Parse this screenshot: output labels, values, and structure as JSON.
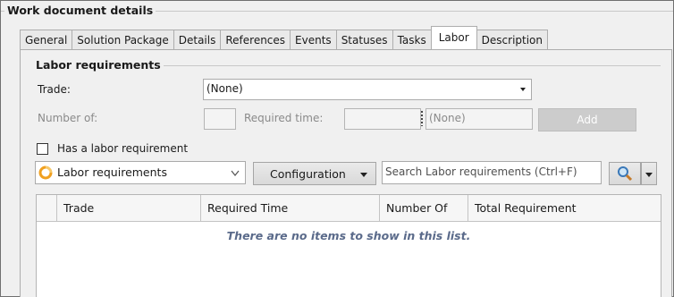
{
  "window": {
    "title": "Work document details"
  },
  "tabs": [
    {
      "label": "General"
    },
    {
      "label": "Solution Package"
    },
    {
      "label": "Details"
    },
    {
      "label": "References"
    },
    {
      "label": "Events"
    },
    {
      "label": "Statuses"
    },
    {
      "label": "Tasks"
    },
    {
      "label": "Labor",
      "active": true
    },
    {
      "label": "Description"
    }
  ],
  "labor_requirements": {
    "group_title": "Labor requirements",
    "trade_label": "Trade:",
    "trade_value": "(None)",
    "number_of_label": "Number of:",
    "number_of_value": "",
    "required_time_label": "Required time:",
    "required_time_value": "",
    "required_time_unit": "(None)",
    "add_label": "Add",
    "has_requirement_label": "Has a labor requirement",
    "has_requirement_checked": false
  },
  "toolbar": {
    "view_select_label": "Labor requirements",
    "configuration_label": "Configuration",
    "search_placeholder": "Search Labor requirements  (Ctrl+F)"
  },
  "grid": {
    "columns": [
      "Trade",
      "Required Time",
      "Number Of",
      "Total Requirement"
    ],
    "rows": [],
    "empty_message": "There are no items to show in this list."
  },
  "colors": {
    "accent_icon": "#f0a020",
    "empty_text": "#5a6a8a",
    "disabled_button": "#cccccc"
  }
}
